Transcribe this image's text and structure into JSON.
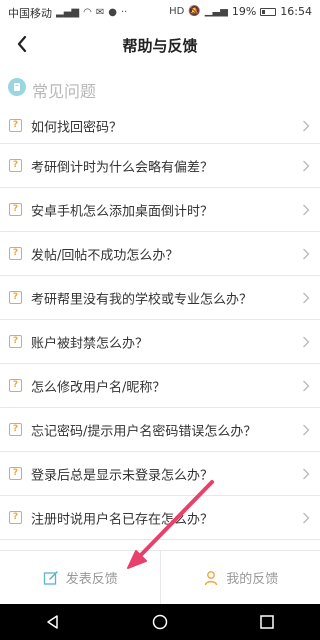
{
  "status_bar": {
    "carrier": "中国移动",
    "network": "HD",
    "battery_percent": "19%",
    "time": "16:54"
  },
  "header": {
    "title": "帮助与反馈"
  },
  "section": {
    "title": "常见问题"
  },
  "faq": {
    "badge": "?",
    "items": [
      "如何找回密码？",
      "考研倒计时为什么会略有偏差？",
      "安卓手机怎么添加桌面倒计时？",
      "发帖/回帖不成功怎么办？",
      "考研帮里没有我的学校或专业怎么办？",
      "账户被封禁怎么办？",
      "怎么修改用户名/昵称？",
      "忘记密码/提示用户名密码错误怎么办？",
      "登录后总是显示未登录怎么办？",
      "注册时说用户名已存在怎么办？"
    ]
  },
  "bottom": {
    "post_feedback": "发表反馈",
    "my_feedback": "我的反馈"
  },
  "colors": {
    "accent_orange": "#f3a43a",
    "teal_icon": "#9ad6df",
    "annotation_arrow": "#e8406a"
  }
}
